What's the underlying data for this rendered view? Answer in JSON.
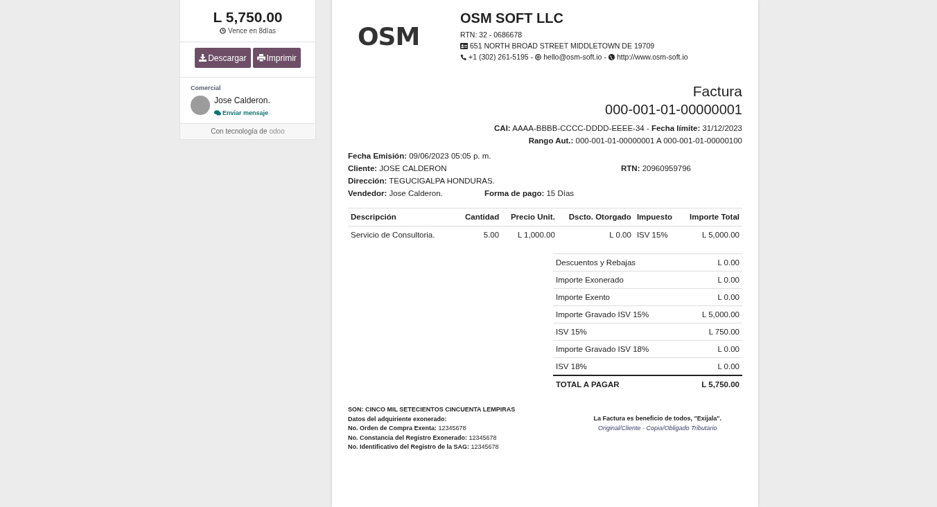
{
  "sidebar": {
    "amount": "L 5,750.00",
    "due": "Vence en 8días",
    "buttons": [
      {
        "kind": "download",
        "label": "Descargar"
      },
      {
        "kind": "print",
        "label": "Imprimir"
      }
    ],
    "salesperson_heading": "Comercial",
    "salesperson": "Jose Calderon.",
    "message_link": "Enviar mensaje",
    "powered_by": "Con tecnología de",
    "powered_brand": "odoo"
  },
  "document": {
    "logo": "OSM",
    "company": "OSM SOFT LLC",
    "company_rtn": "RTN: 32 - 0686678",
    "address": "651 NORTH BROAD STREET MIDDLETOWN DE 19709",
    "phone": "+1 (302) 261-5195",
    "contact_separators": [
      "-",
      "-"
    ],
    "email": "hello@osm-soft.io",
    "website": "http://www.osm-soft.io",
    "title": "Factura",
    "number": "000-001-01-00000001",
    "cai_line": "**CAI:** AAAA-BBBB-CCCC-DDDD-EEEE-34 - **Fecha límite:** 31/12/2023",
    "range_line": "**Rango Aut.:** 000-001-01-00000001 A 000-001-01-00000100",
    "info_rows": [
      [
        "**Fecha Emisión:** 09/06/2023 05:05 p. m."
      ],
      [
        "**Cliente:** JOSE CALDERON",
        "**RTN:** 20960959796"
      ],
      [
        "**Dirección:** TEGUCIGALPA HONDURAS."
      ],
      [
        "**Vendedor:** Jose Calderon.",
        "**Forma de pago:** 15 Días"
      ]
    ],
    "table": {
      "columns": [
        "Descripción",
        "Cantidad",
        "Precio Unit.",
        "Dscto. Otorgado",
        "Impuesto",
        "Importe Total"
      ],
      "rows": [
        [
          "Servicio de Consultoria.",
          "5.00",
          "L 1,000.00",
          "L 0.00",
          "ISV 15%",
          "L 5,000.00"
        ]
      ]
    },
    "totals": [
      {
        "kind": "line",
        "label": "Descuentos y Rebajas",
        "value": "L 0.00"
      },
      {
        "kind": "line",
        "label": "Importe Exonerado",
        "value": "L 0.00"
      },
      {
        "kind": "line",
        "label": "Importe Exento",
        "value": "L 0.00"
      },
      {
        "kind": "line",
        "label": "Importe Gravado ISV 15%",
        "value": "L 5,000.00"
      },
      {
        "kind": "line",
        "label": "ISV 15%",
        "value": "L 750.00"
      },
      {
        "kind": "line",
        "label": "Importe Gravado ISV 18%",
        "value": "L 0.00"
      },
      {
        "kind": "line",
        "label": "ISV 18%",
        "value": "L 0.00"
      },
      {
        "kind": "total",
        "label": "TOTAL A PAGAR",
        "value": "L 5,750.00"
      }
    ],
    "amount_words": "SON: CINCO MIL SETECIENTOS CINCUENTA LEMPIRAS",
    "exempt_heading": "Datos del adquiriente exonerado:",
    "exempt_lines": [
      "**No. Orden de Compra Exenta:** 12345678",
      "**No. Constancia del Registro Exonerado:** 12345678",
      "**No. Identificativo del Registro de la SAG:** 12345678"
    ],
    "slogan": "La Factura es beneficio de todos, \"Exijala\".",
    "copy_note": "Original/Cliente - Copia/Obligado Tributario"
  }
}
